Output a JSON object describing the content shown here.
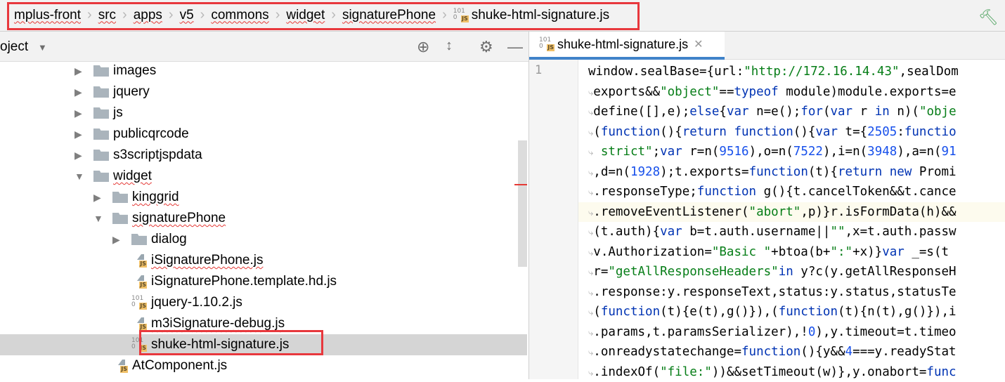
{
  "breadcrumb": {
    "items": [
      "mplus-front",
      "src",
      "apps",
      "v5",
      "commons",
      "widget",
      "signaturePhone"
    ],
    "file": "shuke-html-signature.js"
  },
  "project": {
    "title": "oject"
  },
  "tree": [
    {
      "label": "images",
      "depth": 0,
      "type": "folder",
      "state": "collapsed"
    },
    {
      "label": "jquery",
      "depth": 0,
      "type": "folder",
      "state": "collapsed"
    },
    {
      "label": "js",
      "depth": 0,
      "type": "folder",
      "state": "collapsed"
    },
    {
      "label": "publicqrcode",
      "depth": 0,
      "type": "folder",
      "state": "collapsed"
    },
    {
      "label": "s3scriptjspdata",
      "depth": 0,
      "type": "folder",
      "state": "collapsed"
    },
    {
      "label": "widget",
      "depth": 0,
      "type": "folder",
      "state": "expanded",
      "squiggle": true
    },
    {
      "label": "kinggrid",
      "depth": 1,
      "type": "folder",
      "state": "collapsed",
      "squiggle": true
    },
    {
      "label": "signaturePhone",
      "depth": 1,
      "type": "folder",
      "state": "expanded",
      "squiggle": true
    },
    {
      "label": "dialog",
      "depth": 2,
      "type": "folder",
      "state": "collapsed"
    },
    {
      "label": "iSignaturePhone.js",
      "depth": 2,
      "type": "js",
      "squiggle": true
    },
    {
      "label": "iSignaturePhone.template.hd.js",
      "depth": 2,
      "type": "js"
    },
    {
      "label": "jquery-1.10.2.js",
      "depth": 2,
      "type": "minjs"
    },
    {
      "label": "m3iSignature-debug.js",
      "depth": 2,
      "type": "js",
      "squiggle": true
    },
    {
      "label": "shuke-html-signature.js",
      "depth": 2,
      "type": "minjs",
      "selected": true
    },
    {
      "label": "AtComponent.js",
      "depth": 1,
      "type": "js"
    }
  ],
  "editor": {
    "tab": "shuke-html-signature.js",
    "line_number": "1",
    "lines": [
      [
        [
          "",
          "window.sealBase={url:"
        ],
        [
          "s",
          "\"http://172.16.14.43\""
        ],
        [
          "",
          ",sealDom"
        ]
      ],
      [
        [
          "",
          "exports&&"
        ],
        [
          "s",
          "\"object\""
        ],
        [
          "",
          "=="
        ],
        [
          "k",
          "typeof"
        ],
        [
          "",
          " module)module.exports=e"
        ]
      ],
      [
        [
          "",
          "define([],e);"
        ],
        [
          "k",
          "else"
        ],
        [
          "",
          "{"
        ],
        [
          "k",
          "var"
        ],
        [
          "",
          " n=e();"
        ],
        [
          "k",
          "for"
        ],
        [
          "",
          "("
        ],
        [
          "k",
          "var"
        ],
        [
          "",
          " r "
        ],
        [
          "k",
          "in"
        ],
        [
          "",
          " n)("
        ],
        [
          "s",
          "\"obje"
        ]
      ],
      [
        [
          "",
          "("
        ],
        [
          "k",
          "function"
        ],
        [
          "",
          "(){"
        ],
        [
          "k",
          "return function"
        ],
        [
          "",
          "(){"
        ],
        [
          "k",
          "var"
        ],
        [
          "",
          " t={"
        ],
        [
          "n",
          "2505"
        ],
        [
          "",
          ":"
        ],
        [
          "k",
          "functio"
        ]
      ],
      [
        [
          "s",
          " strict\""
        ],
        [
          "",
          ";"
        ],
        [
          "k",
          "var"
        ],
        [
          "",
          " r=n("
        ],
        [
          "n",
          "9516"
        ],
        [
          "",
          "),o=n("
        ],
        [
          "n",
          "7522"
        ],
        [
          "",
          "),i=n("
        ],
        [
          "n",
          "3948"
        ],
        [
          "",
          "),a=n("
        ],
        [
          "n",
          "91"
        ]
      ],
      [
        [
          "",
          ",d=n("
        ],
        [
          "n",
          "1928"
        ],
        [
          "",
          ");t.exports="
        ],
        [
          "k",
          "function"
        ],
        [
          "",
          "(t){"
        ],
        [
          "k",
          "return new"
        ],
        [
          "",
          " Promi"
        ]
      ],
      [
        [
          "",
          ".responseType;"
        ],
        [
          "k",
          "function"
        ],
        [
          "",
          " g(){t.cancelToken&&t.cance"
        ]
      ],
      [
        [
          "",
          ".removeEventListener("
        ],
        [
          "s",
          "\"abort\""
        ],
        [
          "",
          ",p)}r.isFormData(h)&&"
        ]
      ],
      [
        [
          "",
          "(t.auth){"
        ],
        [
          "k",
          "var"
        ],
        [
          "",
          " b=t.auth.username||"
        ],
        [
          "s",
          "\"\""
        ],
        [
          "",
          ",x=t.auth.passw"
        ]
      ],
      [
        [
          "",
          "v.Authorization="
        ],
        [
          "s",
          "\"Basic \""
        ],
        [
          "",
          "+btoa(b+"
        ],
        [
          "s",
          "\":\""
        ],
        [
          "",
          "+x)}"
        ],
        [
          "k",
          "var"
        ],
        [
          "",
          " _=s(t"
        ]
      ],
      [
        [
          "",
          "r="
        ],
        [
          "s",
          "\"getAllResponseHeaders\""
        ],
        [
          "k",
          "in"
        ],
        [
          "",
          " y?c(y.getAllResponseH"
        ]
      ],
      [
        [
          "",
          ".response:y.responseText,status:y.status,statusTe"
        ]
      ],
      [
        [
          "",
          "("
        ],
        [
          "k",
          "function"
        ],
        [
          "",
          "(t){e(t),g()}),("
        ],
        [
          "k",
          "function"
        ],
        [
          "",
          "(t){n(t),g()}),i"
        ]
      ],
      [
        [
          "",
          ".params,t.paramsSerializer),!"
        ],
        [
          "n",
          "0"
        ],
        [
          "",
          "),y.timeout=t.timeo"
        ]
      ],
      [
        [
          "",
          ".onreadystatechange="
        ],
        [
          "k",
          "function"
        ],
        [
          "",
          "(){y&&"
        ],
        [
          "n",
          "4"
        ],
        [
          "",
          "===y.readyStat"
        ]
      ],
      [
        [
          "",
          ".indexOf("
        ],
        [
          "s",
          "\"file:\""
        ],
        [
          "",
          "))&&setTimeout(w)},y.onabort="
        ],
        [
          "k",
          "func"
        ]
      ]
    ]
  },
  "colors": {
    "highlight_box": "#e8383d",
    "keyword": "#0033b3",
    "string": "#067d17",
    "number": "#1750eb"
  }
}
